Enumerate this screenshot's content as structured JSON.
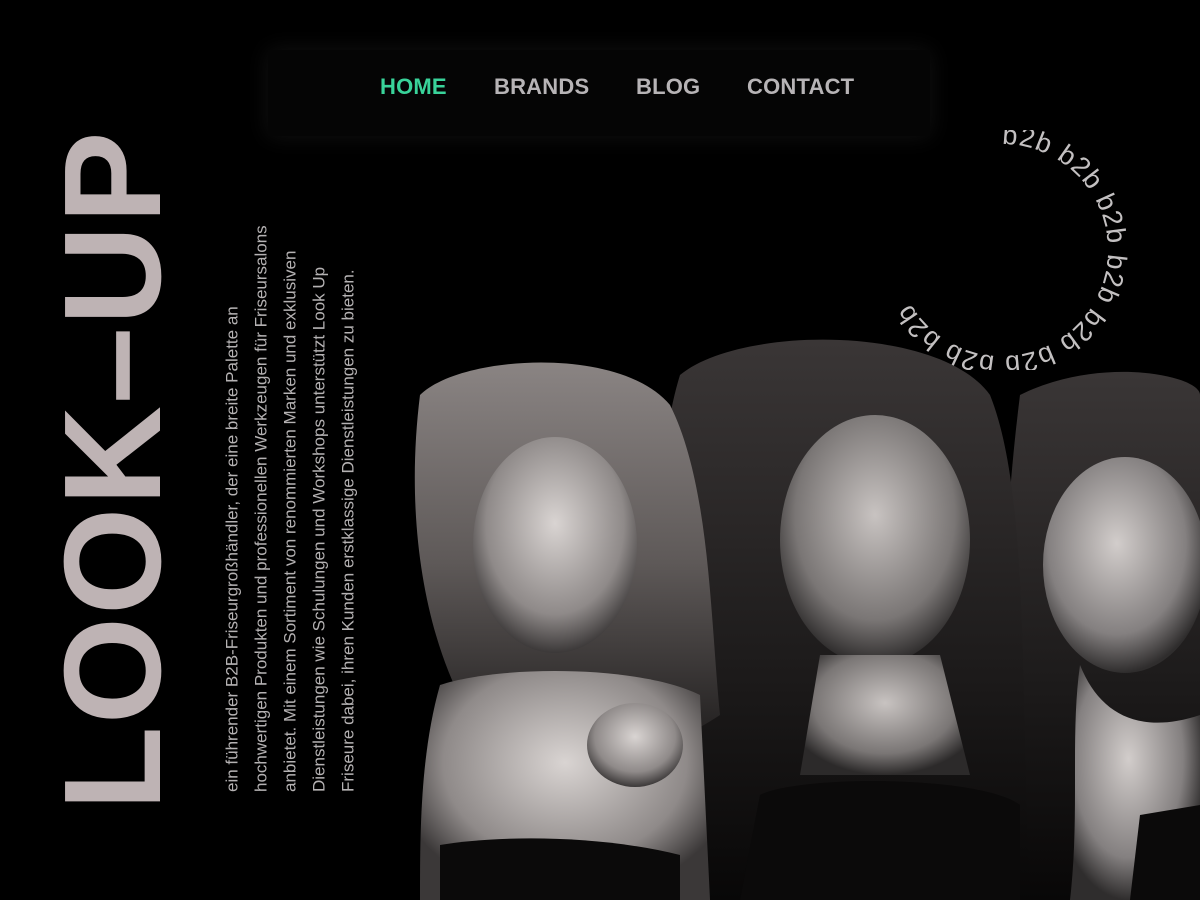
{
  "nav": {
    "items": [
      {
        "label": "HOME",
        "active": true
      },
      {
        "label": "BRANDS",
        "active": false
      },
      {
        "label": "BLOG",
        "active": false
      },
      {
        "label": "CONTACT",
        "active": false
      }
    ]
  },
  "hero": {
    "brand": "LOOK–UP",
    "description": "ein führender B2B-Friseurgroßhändler, der eine breite Palette an hochwertigen Produkten und professionellen Werkzeugen für Friseursalons anbietet. Mit einem Sortiment von renommierten Marken und exklusiven Dienstleistungen wie Schulungen und Workshops unterstützt Look Up Friseure dabei, ihren Kunden erstklassige Dienstleistungen zu bieten.",
    "badge_text": "b2b b2b b2b b2b b2b b2b b2b b2b"
  },
  "colors": {
    "background": "#000000",
    "nav_active": "#39d39a",
    "nav_text": "#b7b4b6",
    "brand_text": "#beb3b4"
  },
  "icons": {
    "photo": "three-women-portrait-image"
  }
}
